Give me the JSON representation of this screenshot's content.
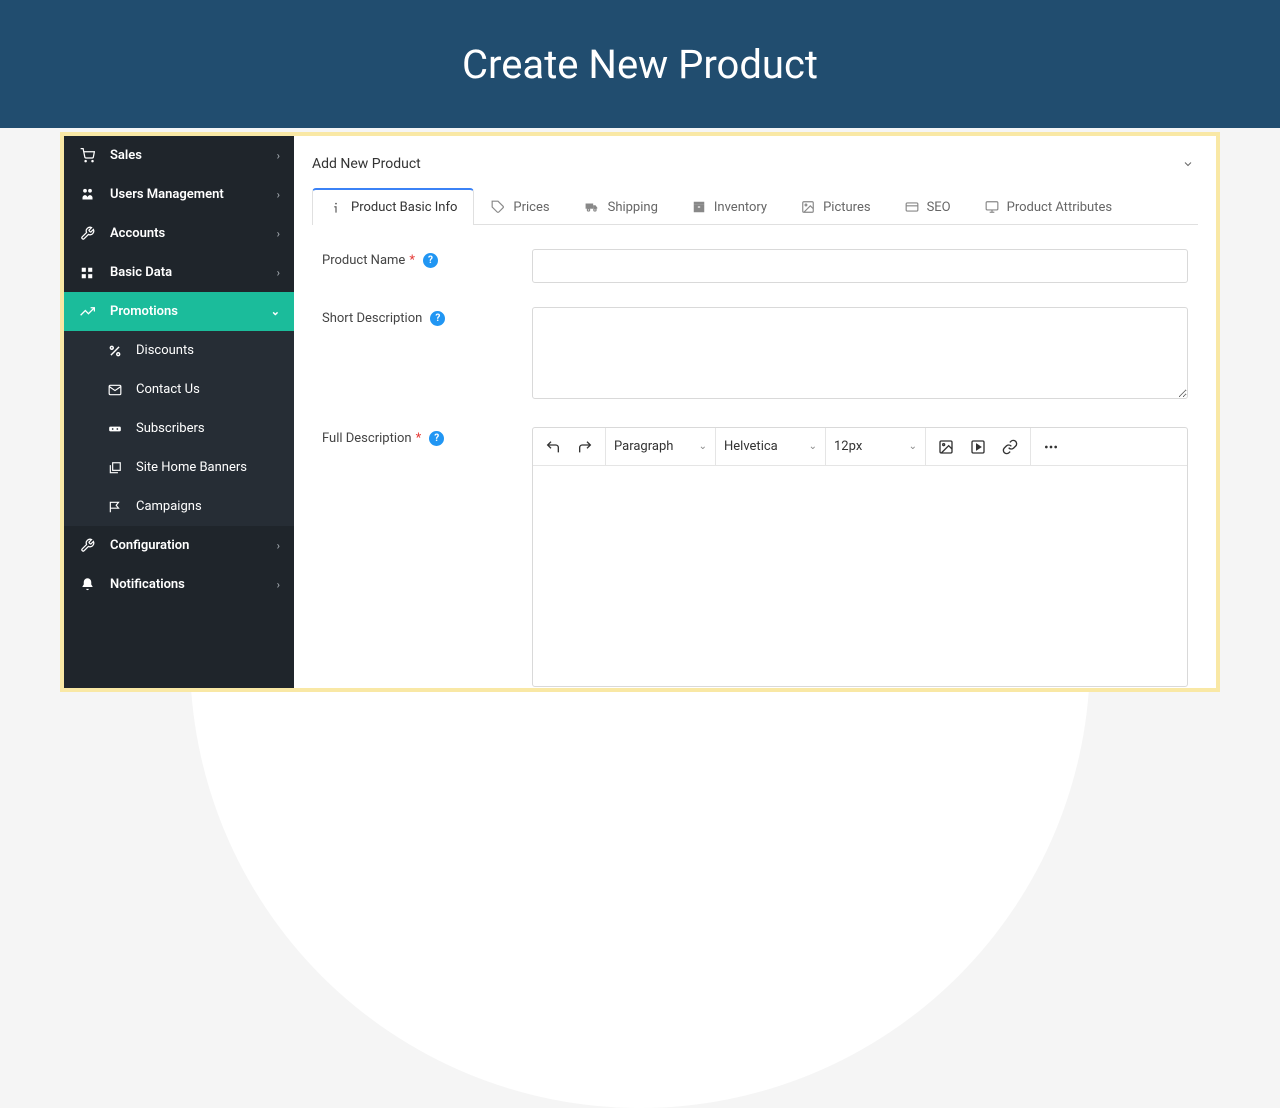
{
  "header": {
    "title": "Create New Product"
  },
  "panel": {
    "title": "Add New Product"
  },
  "sidebar": {
    "items": [
      {
        "label": "Sales",
        "icon": "cart"
      },
      {
        "label": "Users Management",
        "icon": "users"
      },
      {
        "label": "Accounts",
        "icon": "wrench"
      },
      {
        "label": "Basic Data",
        "icon": "grid"
      },
      {
        "label": "Promotions",
        "icon": "trend",
        "active": true
      },
      {
        "label": "Configuration",
        "icon": "wrench2"
      },
      {
        "label": "Notifications",
        "icon": "bell"
      }
    ],
    "promotions_sub": [
      {
        "label": "Discounts",
        "icon": "percent"
      },
      {
        "label": "Contact Us",
        "icon": "mail"
      },
      {
        "label": "Subscribers",
        "icon": "dots"
      },
      {
        "label": "Site Home Banners",
        "icon": "layers"
      },
      {
        "label": "Campaigns",
        "icon": "flag"
      }
    ]
  },
  "tabs": [
    {
      "label": "Product Basic Info",
      "icon": "info",
      "active": true
    },
    {
      "label": "Prices",
      "icon": "tag"
    },
    {
      "label": "Shipping",
      "icon": "truck"
    },
    {
      "label": "Inventory",
      "icon": "box"
    },
    {
      "label": "Pictures",
      "icon": "image"
    },
    {
      "label": "SEO",
      "icon": "card"
    },
    {
      "label": "Product Attributes",
      "icon": "monitor"
    }
  ],
  "form": {
    "product_name": {
      "label": "Product Name",
      "required": true,
      "value": ""
    },
    "short_desc": {
      "label": "Short Description",
      "required": false,
      "value": ""
    },
    "full_desc": {
      "label": "Full Description",
      "required": true,
      "value": ""
    }
  },
  "rte": {
    "paragraph": "Paragraph",
    "font": "Helvetica",
    "size": "12px"
  }
}
